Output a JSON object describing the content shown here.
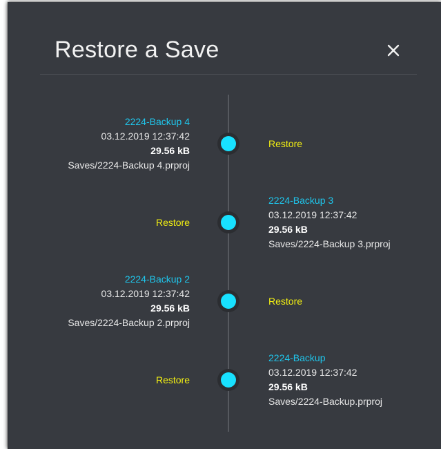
{
  "dialog": {
    "title": "Restore a Save",
    "close_icon": "close-icon"
  },
  "colors": {
    "background": "#373a40",
    "accent_name": "#1fc6ec",
    "restore_link": "#f3f012",
    "node": "#18e1ff"
  },
  "backups": [
    {
      "name": "2224-Backup 4",
      "date": "03.12.2019 12:37:42",
      "size": "29.56 kB",
      "path": "Saves/2224-Backup 4.prproj",
      "action": "Restore"
    },
    {
      "name": "2224-Backup 3",
      "date": "03.12.2019 12:37:42",
      "size": "29.56 kB",
      "path": "Saves/2224-Backup 3.prproj",
      "action": "Restore"
    },
    {
      "name": "2224-Backup 2",
      "date": "03.12.2019 12:37:42",
      "size": "29.56 kB",
      "path": "Saves/2224-Backup 2.prproj",
      "action": "Restore"
    },
    {
      "name": "2224-Backup",
      "date": "03.12.2019 12:37:42",
      "size": "29.56 kB",
      "path": "Saves/2224-Backup.prproj",
      "action": "Restore"
    }
  ]
}
